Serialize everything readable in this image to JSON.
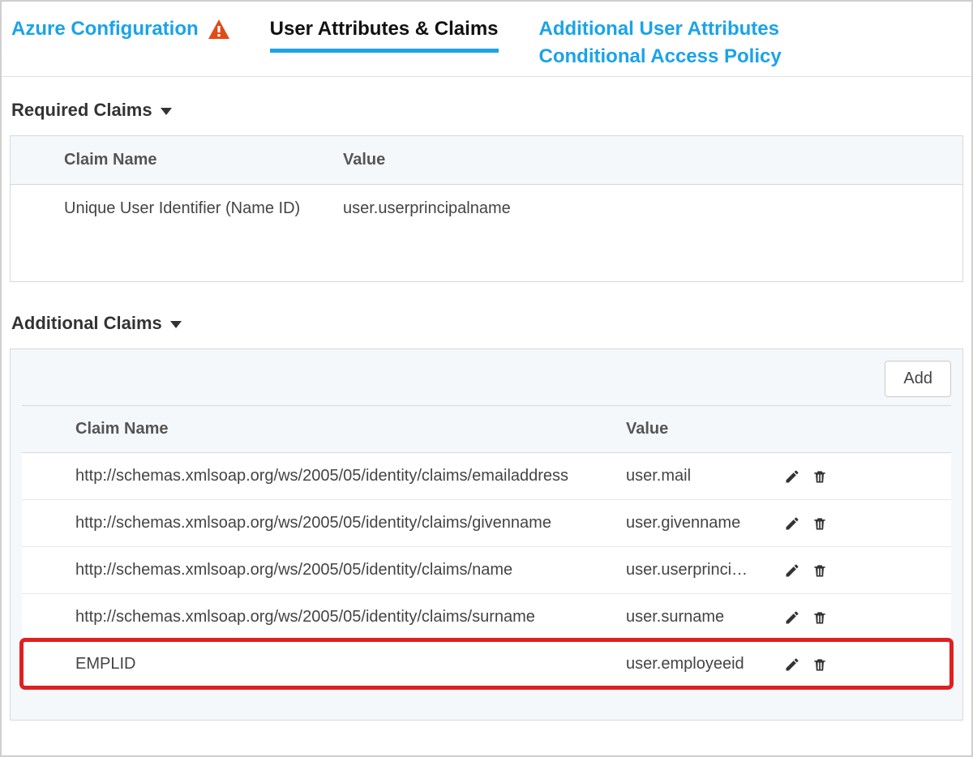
{
  "tabs": {
    "azure": "Azure Configuration",
    "attributes": "User Attributes & Claims",
    "additional": "Additional User Attributes",
    "conditional": "Conditional Access Policy"
  },
  "required": {
    "title": "Required Claims",
    "headers": {
      "name": "Claim Name",
      "value": "Value"
    },
    "rows": [
      {
        "name": "Unique User Identifier (Name ID)",
        "value": "user.userprincipalname"
      }
    ]
  },
  "additional": {
    "title": "Additional Claims",
    "add_label": "Add",
    "headers": {
      "name": "Claim Name",
      "value": "Value"
    },
    "rows": [
      {
        "name": "http://schemas.xmlsoap.org/ws/2005/05/identity/claims/emailaddress",
        "value": "user.mail"
      },
      {
        "name": "http://schemas.xmlsoap.org/ws/2005/05/identity/claims/givenname",
        "value": "user.givenname"
      },
      {
        "name": "http://schemas.xmlsoap.org/ws/2005/05/identity/claims/name",
        "value": "user.userprinci…"
      },
      {
        "name": "http://schemas.xmlsoap.org/ws/2005/05/identity/claims/surname",
        "value": "user.surname"
      },
      {
        "name": "EMPLID",
        "value": "user.employeeid"
      }
    ],
    "highlight_index": 4
  }
}
